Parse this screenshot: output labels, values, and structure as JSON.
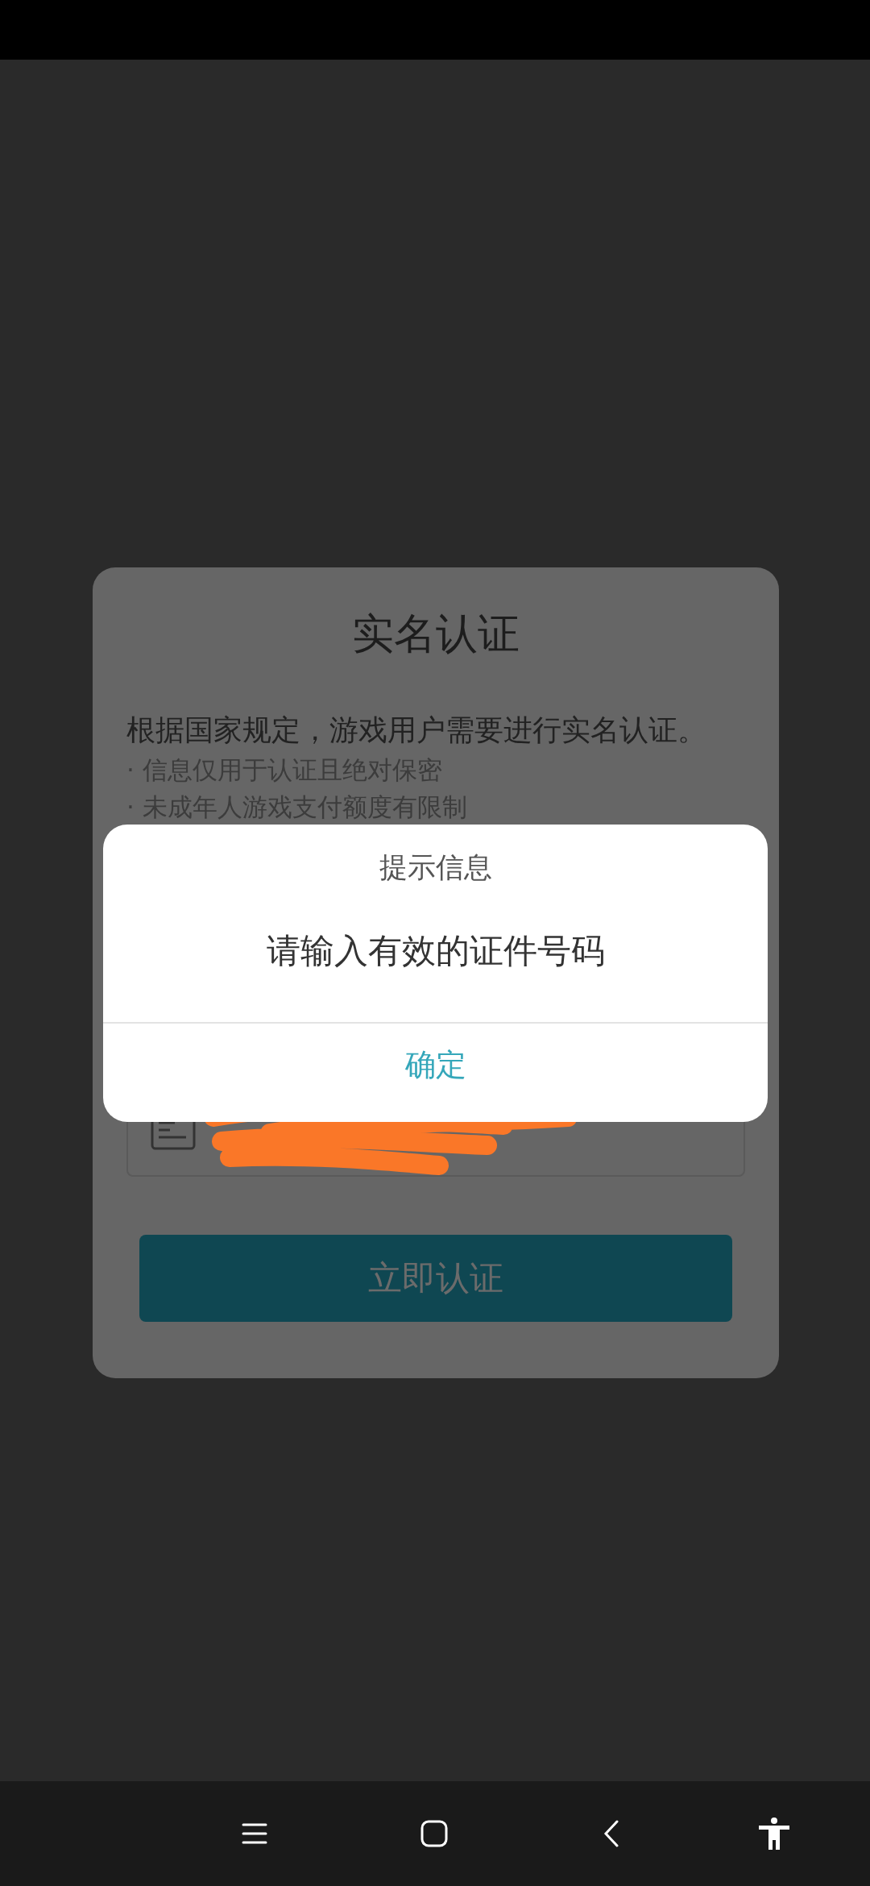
{
  "dialog": {
    "title": "实名认证",
    "description": "根据国家规定，游戏用户需要进行实名认证。",
    "notes": [
      "· 信息仅用于认证且绝对保密",
      "· 未成年人游戏支付额度有限制"
    ],
    "id_field": {
      "kind": "id-card"
    },
    "submit_button": "立即认证"
  },
  "alert": {
    "title": "提示信息",
    "message": "请输入有效的证件号码",
    "confirm_button": "确定"
  },
  "nav_bar": {
    "buttons": [
      {
        "kind": "recents"
      },
      {
        "kind": "home"
      },
      {
        "kind": "back"
      },
      {
        "kind": "accessibility"
      }
    ]
  }
}
